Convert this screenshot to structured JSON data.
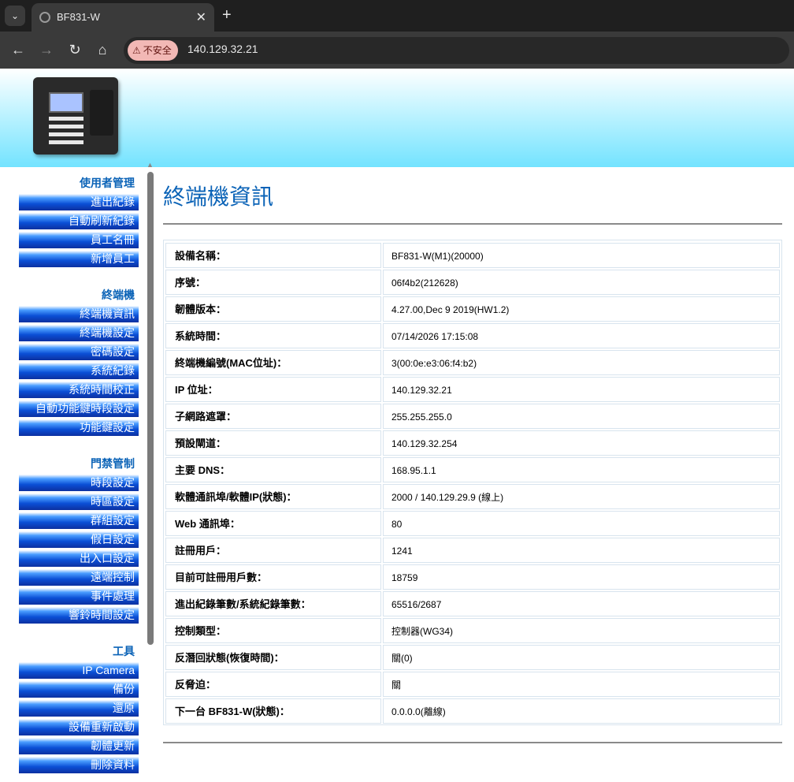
{
  "browser": {
    "tab_title": "BF831-W",
    "insecure_label": "不安全",
    "url": "140.129.32.21"
  },
  "sidebar": {
    "groups": [
      {
        "title": "使用者管理",
        "items": [
          "進出紀錄",
          "自動刷新紀錄",
          "員工名冊",
          "新增員工"
        ]
      },
      {
        "title": "終端機",
        "items": [
          "終端機資訊",
          "終端機設定",
          "密碼設定",
          "系統紀錄",
          "系統時間校正",
          "自動功能鍵時段設定",
          "功能鍵設定"
        ]
      },
      {
        "title": "門禁管制",
        "items": [
          "時段設定",
          "時區設定",
          "群組設定",
          "假日設定",
          "出入口設定",
          "遠端控制",
          "事件處理",
          "響鈴時間設定"
        ]
      },
      {
        "title": "工具",
        "items": [
          "IP Camera",
          "備份",
          "還原",
          "設備重新啟動",
          "韌體更新",
          "刪除資料"
        ]
      }
    ]
  },
  "main": {
    "title": "終端機資訊",
    "rows": [
      {
        "label": "設備名稱：",
        "value": "BF831-W(M1)(20000)"
      },
      {
        "label": "序號：",
        "value": "06f4b2(212628)"
      },
      {
        "label": "韌體版本：",
        "value": "4.27.00,Dec 9 2019(HW1.2)"
      },
      {
        "label": "系統時間：",
        "value": "07/14/2026 17:15:08"
      },
      {
        "label": "終端機編號(MAC位址)：",
        "value": "3(00:0e:e3:06:f4:b2)"
      },
      {
        "label": "IP 位址：",
        "value": "140.129.32.21"
      },
      {
        "label": "子網路遮罩：",
        "value": "255.255.255.0"
      },
      {
        "label": "預設閘道：",
        "value": "140.129.32.254"
      },
      {
        "label": "主要 DNS：",
        "value": "168.95.1.1"
      },
      {
        "label": "軟體通訊埠/軟體IP(狀態)：",
        "value": "2000 / 140.129.29.9 (線上)"
      },
      {
        "label": "Web 通訊埠：",
        "value": "80"
      },
      {
        "label": "註冊用戶：",
        "value": "1241"
      },
      {
        "label": "目前可註冊用戶數：",
        "value": "18759"
      },
      {
        "label": "進出紀錄筆數/系統紀錄筆數：",
        "value": "65516/2687"
      },
      {
        "label": "控制類型：",
        "value": "控制器(WG34)"
      },
      {
        "label": "反潛回狀態(恢復時間)：",
        "value": "關(0)"
      },
      {
        "label": "反脅迫：",
        "value": "關"
      },
      {
        "label": "下一台 BF831-W(狀態)：",
        "value": "0.0.0.0(離線)"
      }
    ]
  }
}
